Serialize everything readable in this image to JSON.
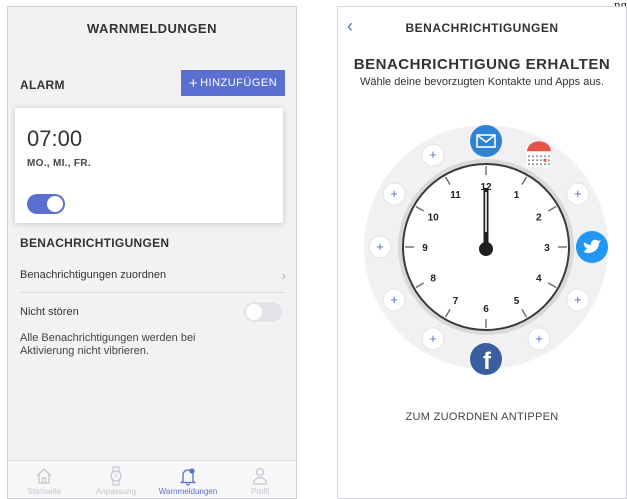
{
  "corner_text": "ng",
  "warnmeldungen": {
    "title": "WARNMELDUNGEN",
    "alarm_label": "ALARM",
    "add_button": "HINZUFÜGEN",
    "alarm": {
      "time": "07:00",
      "days": "MO., MI., FR.",
      "enabled": true
    },
    "notifications_label": "BENACHRICHTIGUNGEN",
    "assign_label": "Benachrichtigungen zuordnen",
    "dnd_label": "Nicht stören",
    "dnd_enabled": false,
    "dnd_description": "Alle Benachrichtigungen werden bei Aktivierung nicht vibrieren.",
    "tabs": [
      {
        "label": "Startseite",
        "icon": "home-icon",
        "active": false
      },
      {
        "label": "Anpassung",
        "icon": "watch-icon",
        "active": false
      },
      {
        "label": "Warnmeldungen",
        "icon": "bell-icon",
        "active": true
      },
      {
        "label": "Profil",
        "icon": "person-icon",
        "active": false
      }
    ]
  },
  "benachrichtigungen": {
    "title": "BENACHRICHTIGUNGEN",
    "heading": "BENACHRICHTIGUNG ERHALTEN",
    "subtitle": "Wähle deine bevorzugten Kontakte und Apps aus.",
    "clock_numbers": [
      "12",
      "1",
      "2",
      "3",
      "4",
      "5",
      "6",
      "7",
      "8",
      "9",
      "10",
      "11"
    ],
    "tap_hint": "ZUM ZUORDNEN ANTIPPEN",
    "assigned_apps": [
      {
        "hour": 12,
        "icon": "mail-icon"
      },
      {
        "hour": 1,
        "icon": "calendar-icon"
      },
      {
        "hour": 3,
        "icon": "twitter-icon"
      },
      {
        "hour": 6,
        "icon": "facebook-icon"
      }
    ]
  },
  "colors": {
    "accent": "#5a6fd0",
    "mail": "#2e83d6",
    "twitter": "#2196f3",
    "facebook": "#3b5e9f",
    "calendar": "#e5534b"
  }
}
